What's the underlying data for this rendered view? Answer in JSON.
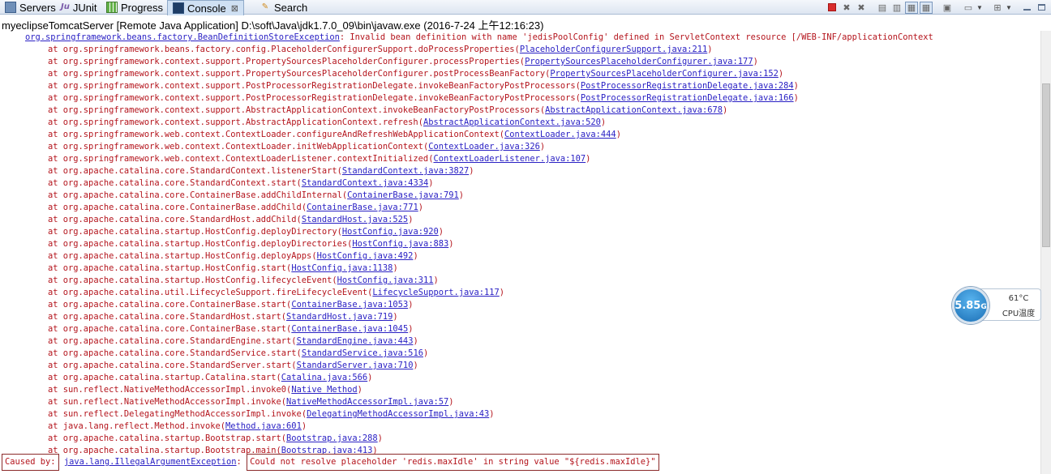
{
  "tabs": [
    {
      "label": "Servers",
      "icon": "servers-icon"
    },
    {
      "label": "JUnit",
      "icon": "junit-icon",
      "glyph": "Ju"
    },
    {
      "label": "Progress",
      "icon": "progress-icon"
    },
    {
      "label": "Console",
      "icon": "console-icon",
      "close": "⊠"
    },
    {
      "label": "Search",
      "icon": "search-icon"
    }
  ],
  "process_label": "myeclipseTomcatServer [Remote Java Application] D:\\soft\\Java\\jdk1.7.0_09\\bin\\javaw.exe (2016-7-24 上午12:16:23)",
  "console": {
    "first_line": {
      "link": "org.springframework.beans.factory.BeanDefinitionStoreException",
      "text": ": Invalid bean definition with name 'jedisPoolConfig' defined in ServletContext resource [/WEB-INF/applicationContext"
    },
    "at_prefix": "at ",
    "stack": [
      {
        "method": "org.springframework.beans.factory.config.PlaceholderConfigurerSupport.doProcessProperties",
        "loc": "PlaceholderConfigurerSupport.java:211"
      },
      {
        "method": "org.springframework.context.support.PropertySourcesPlaceholderConfigurer.processProperties",
        "loc": "PropertySourcesPlaceholderConfigurer.java:177"
      },
      {
        "method": "org.springframework.context.support.PropertySourcesPlaceholderConfigurer.postProcessBeanFactory",
        "loc": "PropertySourcesPlaceholderConfigurer.java:152"
      },
      {
        "method": "org.springframework.context.support.PostProcessorRegistrationDelegate.invokeBeanFactoryPostProcessors",
        "loc": "PostProcessorRegistrationDelegate.java:284"
      },
      {
        "method": "org.springframework.context.support.PostProcessorRegistrationDelegate.invokeBeanFactoryPostProcessors",
        "loc": "PostProcessorRegistrationDelegate.java:166"
      },
      {
        "method": "org.springframework.context.support.AbstractApplicationContext.invokeBeanFactoryPostProcessors",
        "loc": "AbstractApplicationContext.java:678"
      },
      {
        "method": "org.springframework.context.support.AbstractApplicationContext.refresh",
        "loc": "AbstractApplicationContext.java:520"
      },
      {
        "method": "org.springframework.web.context.ContextLoader.configureAndRefreshWebApplicationContext",
        "loc": "ContextLoader.java:444"
      },
      {
        "method": "org.springframework.web.context.ContextLoader.initWebApplicationContext",
        "loc": "ContextLoader.java:326"
      },
      {
        "method": "org.springframework.web.context.ContextLoaderListener.contextInitialized",
        "loc": "ContextLoaderListener.java:107"
      },
      {
        "method": "org.apache.catalina.core.StandardContext.listenerStart",
        "loc": "StandardContext.java:3827"
      },
      {
        "method": "org.apache.catalina.core.StandardContext.start",
        "loc": "StandardContext.java:4334"
      },
      {
        "method": "org.apache.catalina.core.ContainerBase.addChildInternal",
        "loc": "ContainerBase.java:791"
      },
      {
        "method": "org.apache.catalina.core.ContainerBase.addChild",
        "loc": "ContainerBase.java:771"
      },
      {
        "method": "org.apache.catalina.core.StandardHost.addChild",
        "loc": "StandardHost.java:525"
      },
      {
        "method": "org.apache.catalina.startup.HostConfig.deployDirectory",
        "loc": "HostConfig.java:920"
      },
      {
        "method": "org.apache.catalina.startup.HostConfig.deployDirectories",
        "loc": "HostConfig.java:883"
      },
      {
        "method": "org.apache.catalina.startup.HostConfig.deployApps",
        "loc": "HostConfig.java:492"
      },
      {
        "method": "org.apache.catalina.startup.HostConfig.start",
        "loc": "HostConfig.java:1138"
      },
      {
        "method": "org.apache.catalina.startup.HostConfig.lifecycleEvent",
        "loc": "HostConfig.java:311"
      },
      {
        "method": "org.apache.catalina.util.LifecycleSupport.fireLifecycleEvent",
        "loc": "LifecycleSupport.java:117"
      },
      {
        "method": "org.apache.catalina.core.ContainerBase.start",
        "loc": "ContainerBase.java:1053"
      },
      {
        "method": "org.apache.catalina.core.StandardHost.start",
        "loc": "StandardHost.java:719"
      },
      {
        "method": "org.apache.catalina.core.ContainerBase.start",
        "loc": "ContainerBase.java:1045"
      },
      {
        "method": "org.apache.catalina.core.StandardEngine.start",
        "loc": "StandardEngine.java:443"
      },
      {
        "method": "org.apache.catalina.core.StandardService.start",
        "loc": "StandardService.java:516"
      },
      {
        "method": "org.apache.catalina.core.StandardServer.start",
        "loc": "StandardServer.java:710"
      },
      {
        "method": "org.apache.catalina.startup.Catalina.start",
        "loc": "Catalina.java:566"
      },
      {
        "method": "sun.reflect.NativeMethodAccessorImpl.invoke0",
        "loc": "Native Method"
      },
      {
        "method": "sun.reflect.NativeMethodAccessorImpl.invoke",
        "loc": "NativeMethodAccessorImpl.java:57"
      },
      {
        "method": "sun.reflect.DelegatingMethodAccessorImpl.invoke",
        "loc": "DelegatingMethodAccessorImpl.java:43"
      },
      {
        "method": "java.lang.reflect.Method.invoke",
        "loc": "Method.java:601"
      },
      {
        "method": "org.apache.catalina.startup.Bootstrap.start",
        "loc": "Bootstrap.java:288"
      },
      {
        "method": "org.apache.catalina.startup.Bootstrap.main",
        "loc": "Bootstrap.java:413"
      }
    ],
    "caused_by": {
      "prefix": "Caused by:",
      "link": "java.lang.IllegalArgumentException",
      "colon": ":",
      "message": "Could not resolve placeholder 'redis.maxIdle' in string value \"${redis.maxIdle}\""
    }
  },
  "widget": {
    "memory": "5.85",
    "memory_unit": "G",
    "temp": "61°C",
    "temp_label": "CPU温度"
  },
  "colors": {
    "error_text": "#b4141c",
    "link_text": "#2a21c4",
    "terminate": "#d92d2d"
  }
}
